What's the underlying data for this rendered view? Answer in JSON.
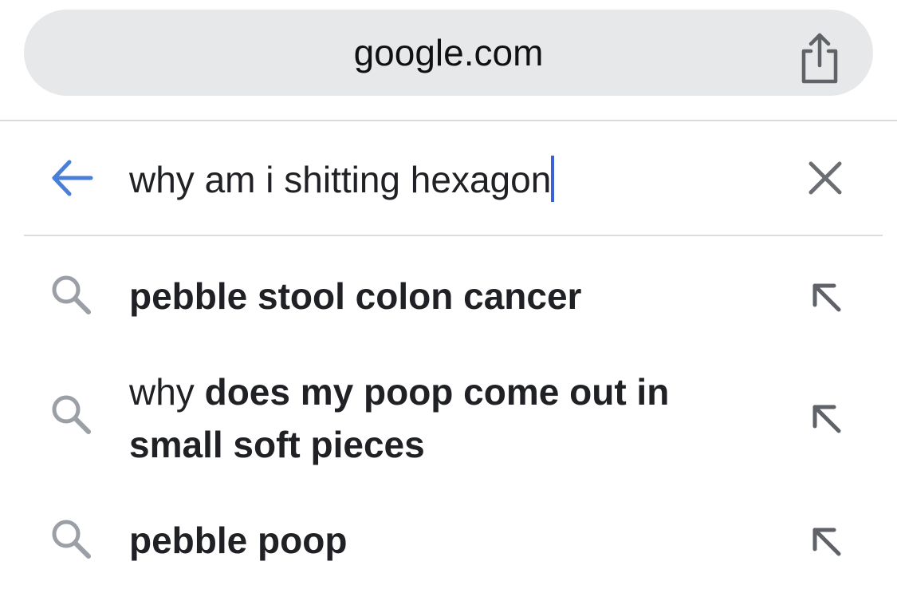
{
  "browser": {
    "url": "google.com",
    "share_icon": "share-icon"
  },
  "search": {
    "query": "why am i shitting hexagon",
    "back_icon": "back-arrow-icon",
    "clear_icon": "close-icon",
    "accent_color": "#4a7fd8",
    "caret_color": "#3a62d6"
  },
  "suggestions": [
    {
      "prefix": "",
      "bold": "pebble stool colon cancer",
      "line2": "",
      "icon": "search-icon",
      "action_icon": "fill-query-arrow-icon"
    },
    {
      "prefix": "why ",
      "bold": "does my poop come out in",
      "line2": "small soft pieces",
      "icon": "search-icon",
      "action_icon": "fill-query-arrow-icon"
    },
    {
      "prefix": "",
      "bold": "pebble poop",
      "line2": "",
      "icon": "search-icon",
      "action_icon": "fill-query-arrow-icon"
    }
  ]
}
